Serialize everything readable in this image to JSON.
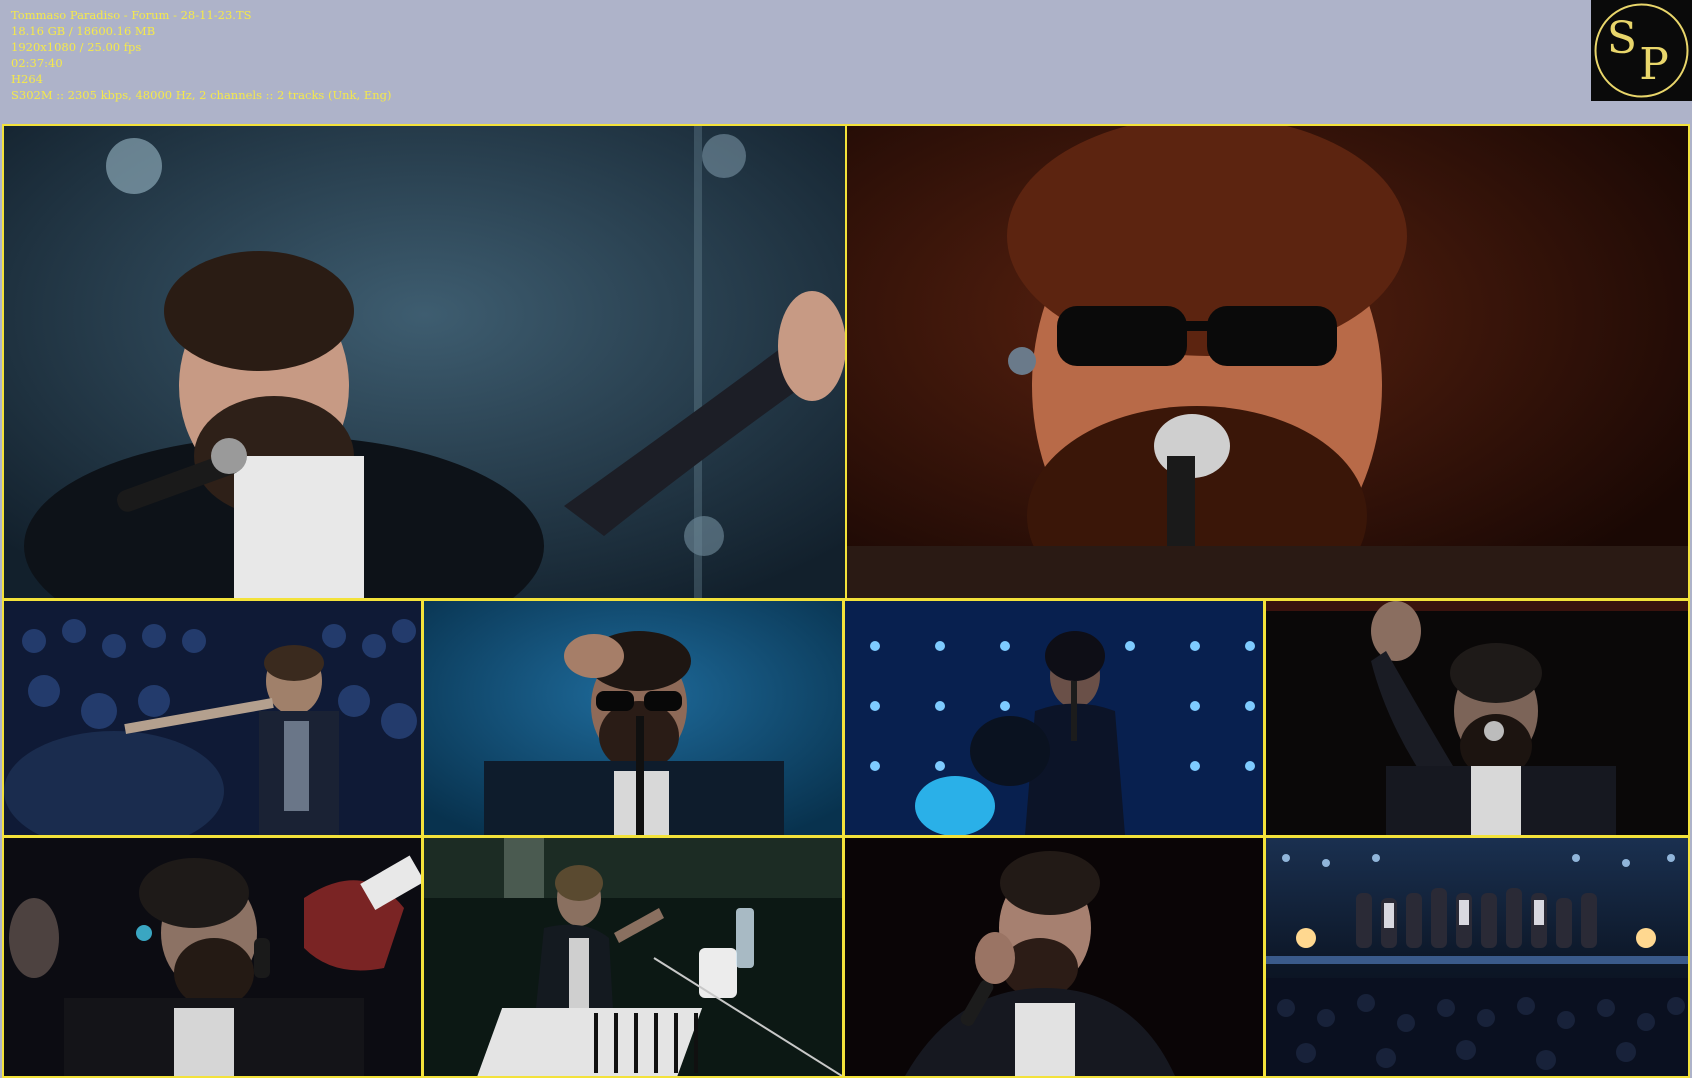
{
  "info": {
    "filename": "Tommaso Paradiso - Forum - 28-11-23.TS",
    "size": "18.16 GB / 18600.16 MB",
    "resolution": "1920x1080 / 25.00 fps",
    "duration": "02:37:40",
    "codec": "H264",
    "audio": "S302M :: 2305 kbps, 48000 Hz, 2 channels :: 2 tracks (Unk, Eng)"
  },
  "logo": {
    "letters": "SP",
    "s": "S",
    "p": "P",
    "color": "#e9d66b"
  },
  "colors": {
    "background": "#aeb3c9",
    "info_text": "#f5e94a",
    "border": "#f3e23a"
  },
  "thumbnails": [
    {
      "id": 1,
      "scene": "singer-arm-raised-blue",
      "bg": "#1c3446",
      "accent": "#7fa8c2"
    },
    {
      "id": 2,
      "scene": "singer-sunglasses-closeup-red",
      "bg": "#2a0c04",
      "accent": "#b04a1a"
    },
    {
      "id": 3,
      "scene": "crowd-blue",
      "bg": "#0d1730",
      "accent": "#4a6aa6"
    },
    {
      "id": 4,
      "scene": "singer-sunglasses-blue",
      "bg": "#0b3a5e",
      "accent": "#2a78a8"
    },
    {
      "id": 5,
      "scene": "female-singer-blue-lights",
      "bg": "#081a4a",
      "accent": "#4fb4ff"
    },
    {
      "id": 6,
      "scene": "singer-hand-up-dark",
      "bg": "#0a0808",
      "accent": "#3a3a46"
    },
    {
      "id": 7,
      "scene": "singer-guitar-dark",
      "bg": "#0c0c12",
      "accent": "#6a3a3a"
    },
    {
      "id": 8,
      "scene": "singer-piano-green",
      "bg": "#0c1814",
      "accent": "#2a4a3a"
    },
    {
      "id": 9,
      "scene": "singer-mic-dark",
      "bg": "#0a0506",
      "accent": "#3a2420"
    },
    {
      "id": 10,
      "scene": "band-stage-bow",
      "bg": "#0a1020",
      "accent": "#5a8ac2"
    }
  ]
}
